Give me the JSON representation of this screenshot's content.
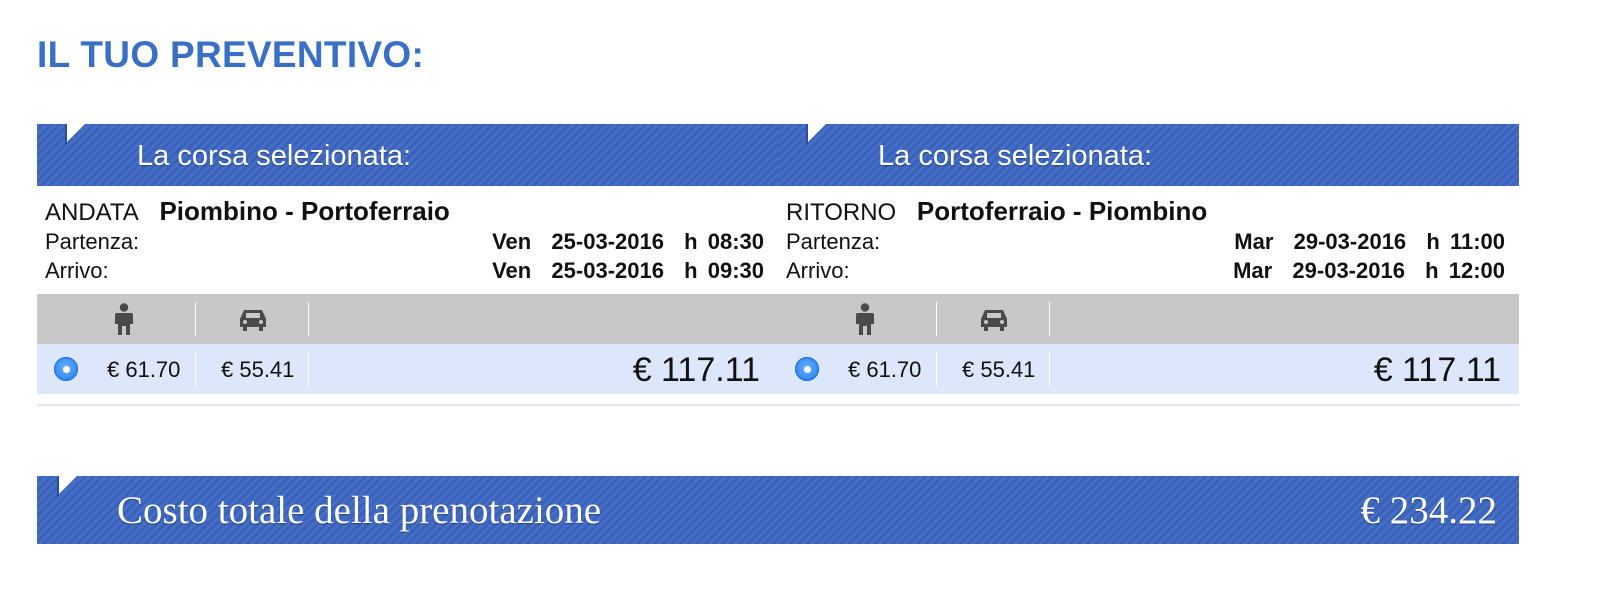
{
  "page_title": "IL TUO PREVENTIVO:",
  "trips": [
    {
      "header": "La corsa selezionata:",
      "direction": "ANDATA",
      "route": "Piombino - Portoferraio",
      "departure_label": "Partenza:",
      "departure_value": "Ven  25-03-2016  h 08:30",
      "arrival_label": "Arrivo:",
      "arrival_value": "Ven  25-03-2016  h 09:30",
      "passenger_icon": "person-icon",
      "vehicle_icon": "car-icon",
      "passenger_price": "€ 61.70",
      "vehicle_price": "€ 55.41",
      "total_price": "€ 117.11",
      "selected": true
    },
    {
      "header": "La corsa selezionata:",
      "direction": "RITORNO",
      "route": "Portoferraio - Piombino",
      "departure_label": "Partenza:",
      "departure_value": "Mar  29-03-2016  h 11:00",
      "arrival_label": "Arrivo:",
      "arrival_value": "Mar  29-03-2016  h 12:00",
      "passenger_icon": "person-icon",
      "vehicle_icon": "car-icon",
      "passenger_price": "€ 61.70",
      "vehicle_price": "€ 55.41",
      "total_price": "€ 117.11",
      "selected": true
    }
  ],
  "summary": {
    "label": "Costo totale della prenotazione",
    "value": "€ 234.22"
  },
  "colors": {
    "title_blue": "#3a6fc6",
    "band_blue": "#3b65c0",
    "price_row_bg": "#dde7fb",
    "icon_row_bg": "#c8c8c8",
    "radio_blue": "#2f86f0"
  }
}
